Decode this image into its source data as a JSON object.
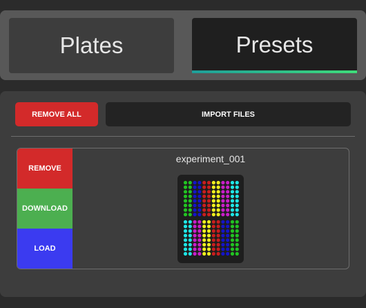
{
  "tabs": {
    "plates_label": "Plates",
    "presets_label": "Presets",
    "active": "Presets",
    "accent_gradient": [
      "#1e9e9a",
      "#3fdc7a"
    ]
  },
  "toolbar": {
    "remove_all_label": "REMOVE ALL",
    "import_files_label": "IMPORT FILES"
  },
  "presets": [
    {
      "name": "experiment_001",
      "actions": {
        "remove_label": "REMOVE",
        "download_label": "DOWNLOAD",
        "load_label": "LOAD"
      },
      "plate_preview": {
        "quadrants": [
          [
            "green",
            "blue",
            "red",
            "yellow",
            "magenta",
            "cyan"
          ],
          [
            "cyan",
            "magenta",
            "yellow",
            "red",
            "blue",
            "green"
          ]
        ],
        "columns_per_color": 2,
        "rows_per_quadrant": 8,
        "colors": {
          "green": "#22c322",
          "blue": "#1414c8",
          "red": "#c81e1e",
          "yellow": "#f0f01e",
          "magenta": "#c81ec8",
          "cyan": "#1ee6e6"
        }
      }
    }
  ],
  "colors": {
    "remove": "#d32a2a",
    "download": "#4caf50",
    "load": "#3b3bf0"
  }
}
